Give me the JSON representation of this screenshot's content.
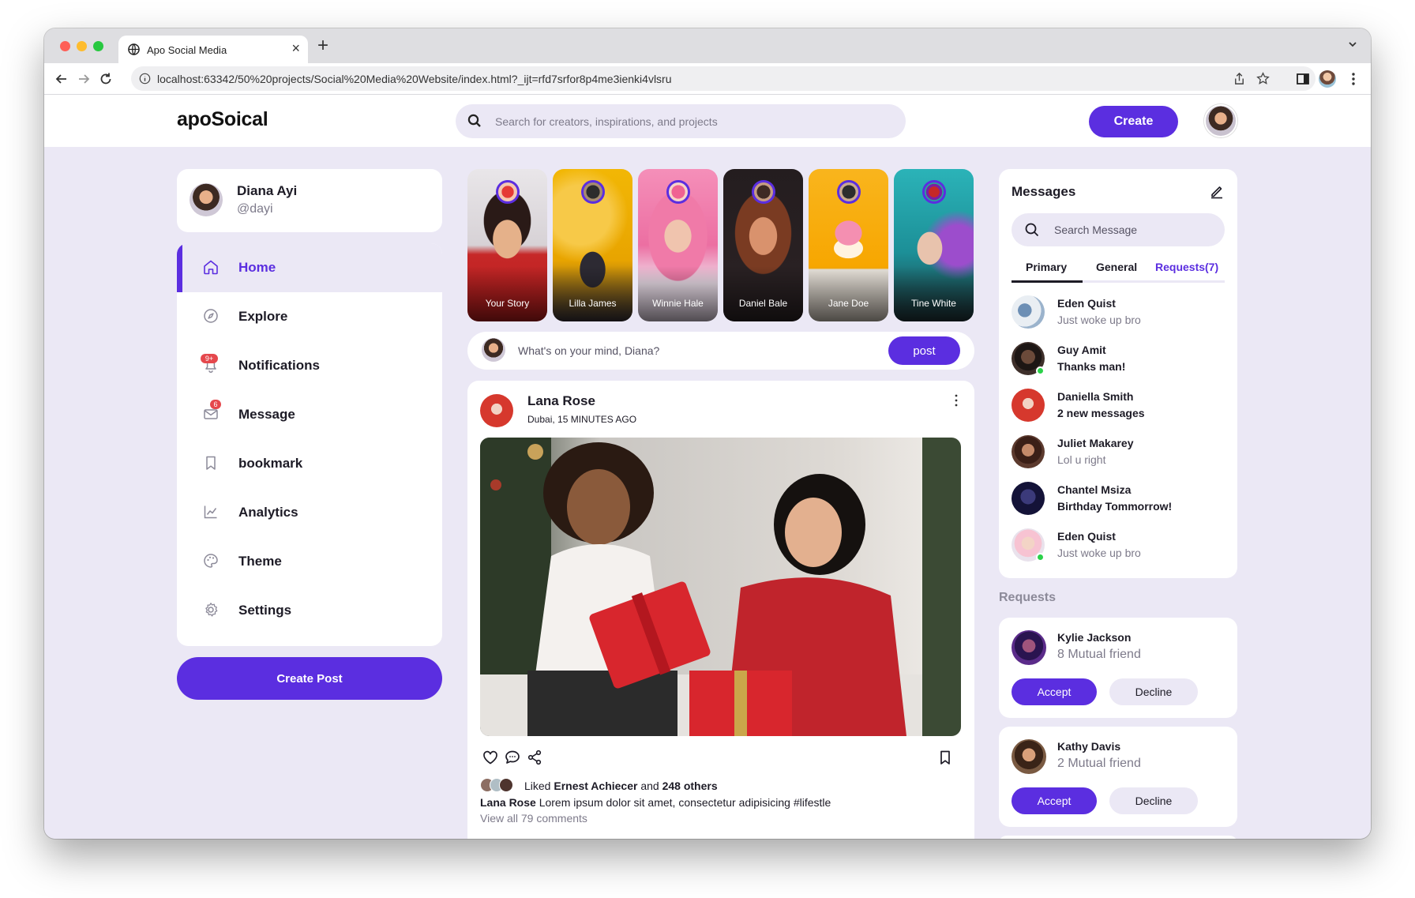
{
  "browser": {
    "tab_title": "Apo Social Media",
    "url": "localhost:63342/50%20projects/Social%20Media%20Website/index.html?_ijt=rfd7srfor8p4me3ienki4vlsru"
  },
  "header": {
    "logo": "apoSoical",
    "search_placeholder": "Search for creators, inspirations, and projects",
    "create_label": "Create"
  },
  "profile": {
    "name": "Diana Ayi",
    "handle": "@dayi"
  },
  "sidebar": {
    "items": [
      {
        "label": "Home",
        "icon": "home-icon",
        "active": true
      },
      {
        "label": "Explore",
        "icon": "compass-icon"
      },
      {
        "label": "Notifications",
        "icon": "bell-icon",
        "badge": "9+"
      },
      {
        "label": "Message",
        "icon": "envelope-icon",
        "badge": "6"
      },
      {
        "label": "bookmark",
        "icon": "bookmark-icon"
      },
      {
        "label": "Analytics",
        "icon": "chart-icon"
      },
      {
        "label": "Theme",
        "icon": "palette-icon"
      },
      {
        "label": "Settings",
        "icon": "gear-icon"
      }
    ],
    "create_post_label": "Create Post"
  },
  "stories": [
    {
      "name": "Your Story"
    },
    {
      "name": "Lilla James"
    },
    {
      "name": "Winnie Hale"
    },
    {
      "name": "Daniel Bale"
    },
    {
      "name": "Jane Doe"
    },
    {
      "name": "Tine White"
    }
  ],
  "composer": {
    "placeholder": "What's on your mind, Diana?",
    "post_label": "post"
  },
  "post": {
    "author": "Lana Rose",
    "meta": "Dubai, 15 MINUTES AGO",
    "liked_prefix": "Liked ",
    "liked_user": "Ernest Achiecer",
    "liked_mid": " and ",
    "liked_count": "248 others",
    "caption_author": "Lana Rose",
    "caption_text": " Lorem ipsum dolor sit amet, consectetur adipisicing #lifestle",
    "comments_link": "View all 79 comments"
  },
  "messages": {
    "title": "Messages",
    "search_placeholder": "Search Message",
    "tabs": {
      "primary": "Primary",
      "general": "General",
      "requests": "Requests(7)"
    },
    "items": [
      {
        "name": "Eden Quist",
        "text": "Just woke up bro",
        "unread": false
      },
      {
        "name": "Guy Amit",
        "text": "Thanks man!",
        "unread": true,
        "online": true
      },
      {
        "name": "Daniella Smith",
        "text": "2 new messages",
        "unread": true
      },
      {
        "name": "Juliet Makarey",
        "text": "Lol u right",
        "unread": false
      },
      {
        "name": "Chantel Msiza",
        "text": "Birthday Tommorrow!",
        "unread": true
      },
      {
        "name": "Eden Quist",
        "text": "Just woke up bro",
        "unread": false,
        "online": true
      }
    ]
  },
  "requests": {
    "heading": "Requests",
    "accept_label": "Accept",
    "decline_label": "Decline",
    "items": [
      {
        "name": "Kylie Jackson",
        "mutual": "8 Mutual friend"
      },
      {
        "name": "Kathy Davis",
        "mutual": "2 Mutual friend"
      }
    ]
  },
  "colors": {
    "accent": "#5b2ee0",
    "page_background": "#ebe8f5",
    "badge": "#e5484d",
    "online": "#2bd14a"
  }
}
